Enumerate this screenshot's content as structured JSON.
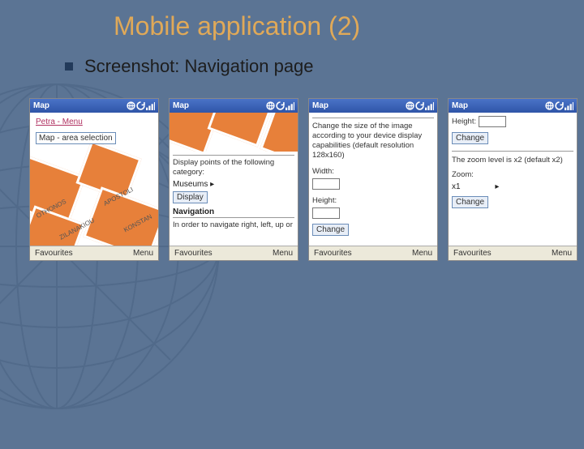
{
  "title": "Mobile application (2)",
  "subtitle": "Screenshot: Navigation page",
  "common": {
    "titlebar": "Map",
    "softkey_left": "Favourites",
    "softkey_right": "Menu"
  },
  "screen1": {
    "link_menu": "Petra - Menu",
    "link_area": "Map - area selection",
    "labels": [
      "OTHONOS",
      "ZILANAKIOU",
      "APOSTOLI",
      "KONSTAN"
    ]
  },
  "screen2": {
    "caption": "Display points of the following category:",
    "category": "Museums",
    "button_display": "Display",
    "section_nav": "Navigation",
    "nav_text": "In order to navigate right, left, up or"
  },
  "screen3": {
    "intro": "Change the size of the image according to your device display capabilities (default resolution 128x160)",
    "label_width": "Width:",
    "label_height": "Height:",
    "button_change": "Change"
  },
  "screen4": {
    "label_height": "Height:",
    "button_change1": "Change",
    "zoom_text": "The zoom level is x2 (default x2)",
    "label_zoom": "Zoom:",
    "zoom_value": "x1",
    "button_change2": "Change"
  }
}
